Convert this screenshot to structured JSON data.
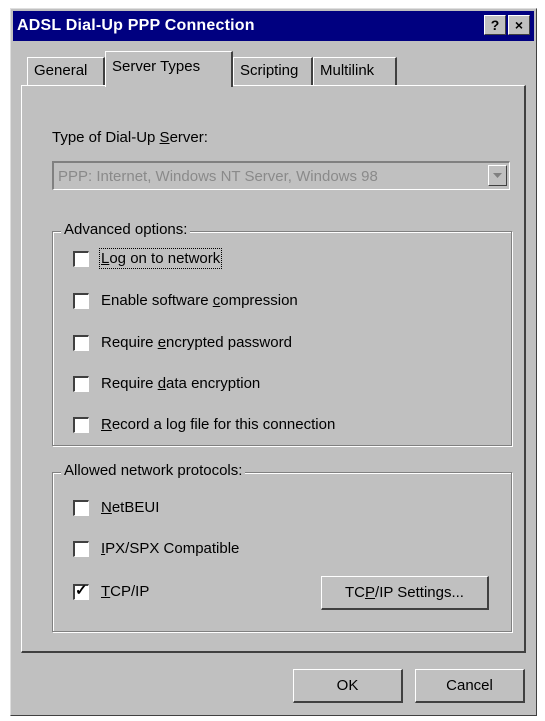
{
  "window": {
    "title": "ADSL Dial-Up PPP Connection",
    "help_label": "?",
    "close_label": "×"
  },
  "tabs": [
    {
      "label": "General"
    },
    {
      "label": "Server Types"
    },
    {
      "label": "Scripting"
    },
    {
      "label": "Multilink"
    }
  ],
  "server_type": {
    "label_pre": "Type of Dial-Up ",
    "label_key": "S",
    "label_post": "erver:",
    "selected": "PPP: Internet, Windows NT Server, Windows 98",
    "enabled": false
  },
  "advanced": {
    "legend": "Advanced options:",
    "options": [
      {
        "pre": "",
        "key": "L",
        "post": "og on to network",
        "checked": false,
        "focused": true
      },
      {
        "pre": "Enable software ",
        "key": "c",
        "post": "ompression",
        "checked": false
      },
      {
        "pre": "Require ",
        "key": "e",
        "post": "ncrypted password",
        "checked": false
      },
      {
        "pre": "Require ",
        "key": "d",
        "post": "ata encryption",
        "checked": false
      },
      {
        "pre": "",
        "key": "R",
        "post": "ecord a log file for this connection",
        "checked": false
      }
    ]
  },
  "protocols": {
    "legend": "Allowed network protocols:",
    "options": [
      {
        "pre": "",
        "key": "N",
        "post": "etBEUI",
        "checked": false
      },
      {
        "pre": "",
        "key": "I",
        "post": "PX/SPX Compatible",
        "checked": false
      },
      {
        "pre": "",
        "key": "T",
        "post": "CP/IP",
        "checked": true
      }
    ],
    "tcpip_button": {
      "pre": "TC",
      "key": "P",
      "post": "/IP Settings..."
    }
  },
  "buttons": {
    "ok": "OK",
    "cancel": "Cancel"
  },
  "checkmark": "✓"
}
